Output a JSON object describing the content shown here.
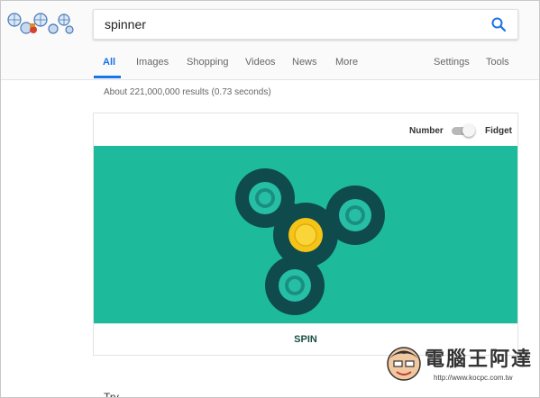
{
  "search": {
    "query": "spinner "
  },
  "tabs": [
    {
      "label": "All",
      "active": true
    },
    {
      "label": "Images"
    },
    {
      "label": "Shopping"
    },
    {
      "label": "Videos"
    },
    {
      "label": "News"
    },
    {
      "label": "More"
    },
    {
      "label": "Settings"
    },
    {
      "label": "Tools"
    }
  ],
  "results_stats": "About 221,000,000 results (0.73 seconds)",
  "spinner_card": {
    "mode_left": "Number",
    "mode_right": "Fidget",
    "mode_selected": "Fidget",
    "spin_label": "SPIN",
    "colors": {
      "background": "#1dbb9c",
      "body": "#0f4b4d",
      "bearing": "#26bfa6",
      "center": "#f6c416"
    }
  },
  "below_card_text": "Try …",
  "watermark": {
    "title": "電腦王阿達",
    "url": "http://www.kocpc.com.tw"
  },
  "icons": [
    "logo-doodle",
    "search-icon"
  ],
  "accent_color": "#1a73e8"
}
